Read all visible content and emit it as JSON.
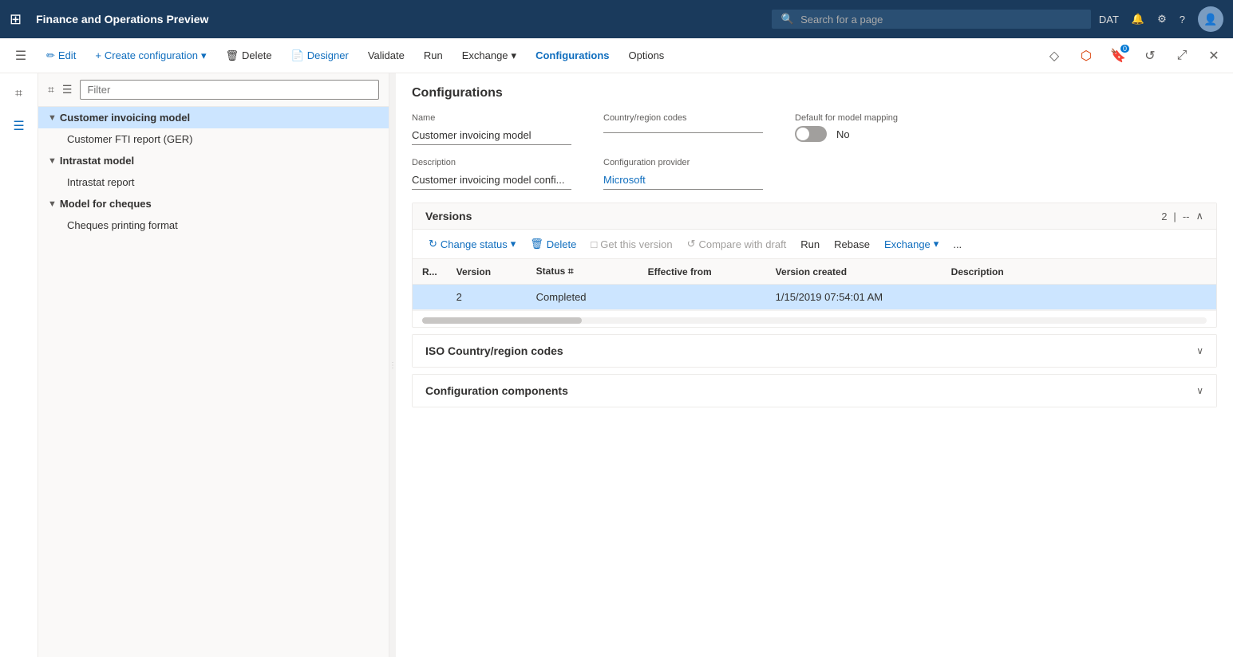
{
  "topbar": {
    "title": "Finance and Operations Preview",
    "search_placeholder": "Search for a page",
    "env": "DAT"
  },
  "cmdbar": {
    "edit": "Edit",
    "create_config": "Create configuration",
    "delete": "Delete",
    "designer": "Designer",
    "validate": "Validate",
    "run": "Run",
    "exchange": "Exchange",
    "configurations": "Configurations",
    "options": "Options"
  },
  "sidebar_icons": [
    "☰",
    "⊞",
    "★",
    "⟳",
    "▦",
    "≡"
  ],
  "filter_placeholder": "Filter",
  "tree": {
    "items": [
      {
        "type": "group",
        "label": "Customer invoicing model",
        "indent": 0,
        "selected": true,
        "collapsed": false
      },
      {
        "type": "child",
        "label": "Customer FTI report (GER)",
        "indent": 1
      },
      {
        "type": "group",
        "label": "Intrastat model",
        "indent": 0,
        "collapsed": false
      },
      {
        "type": "child",
        "label": "Intrastat report",
        "indent": 1
      },
      {
        "type": "group",
        "label": "Model for cheques",
        "indent": 0,
        "collapsed": false
      },
      {
        "type": "child",
        "label": "Cheques printing format",
        "indent": 1
      }
    ]
  },
  "configurations": {
    "section_title": "Configurations",
    "name_label": "Name",
    "name_value": "Customer invoicing model",
    "country_label": "Country/region codes",
    "country_value": "",
    "default_mapping_label": "Default for model mapping",
    "default_mapping_value": "No",
    "description_label": "Description",
    "description_value": "Customer invoicing model confi...",
    "provider_label": "Configuration provider",
    "provider_value": "Microsoft"
  },
  "versions": {
    "title": "Versions",
    "count": "2",
    "separator": "|",
    "dash": "--",
    "toolbar": {
      "change_status": "Change status",
      "delete": "Delete",
      "get_this_version": "Get this version",
      "compare_with_draft": "Compare with draft",
      "run": "Run",
      "rebase": "Rebase",
      "exchange": "Exchange",
      "more": "..."
    },
    "table": {
      "headers": [
        "R...",
        "Version",
        "Status",
        "Effective from",
        "Version created",
        "Description"
      ],
      "rows": [
        {
          "r": "",
          "version": "2",
          "status": "Completed",
          "effective_from": "",
          "version_created": "1/15/2019 07:54:01 AM",
          "description": "",
          "selected": true
        }
      ]
    }
  },
  "iso_section": {
    "title": "ISO Country/region codes",
    "collapsed": true
  },
  "components_section": {
    "title": "Configuration components",
    "collapsed": true
  }
}
